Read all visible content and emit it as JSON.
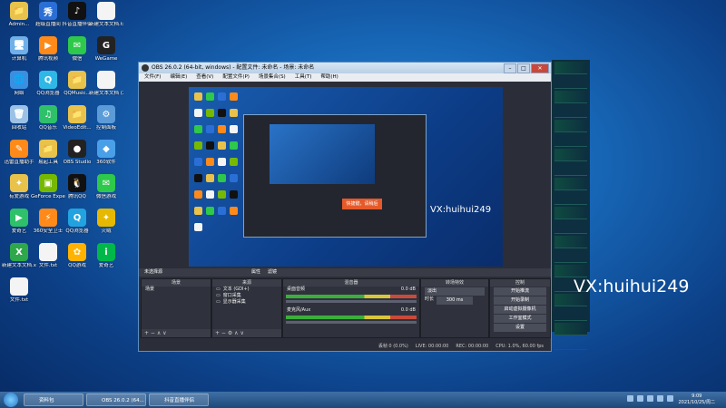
{
  "desktop": {
    "icons": [
      {
        "label": "Admin...",
        "color": "#e8c24a",
        "glyph": "📁"
      },
      {
        "label": "超级直播间",
        "color": "#2b6fd6",
        "glyph": "秀"
      },
      {
        "label": "抖音直播伴侣",
        "color": "#111111",
        "glyph": "♪"
      },
      {
        "label": "新建文本文档.txt",
        "color": "#f4f4f4",
        "glyph": ""
      },
      {
        "label": "计算机",
        "color": "#6fb0e8",
        "glyph": "🖥"
      },
      {
        "label": "腾讯视频",
        "color": "#ff8a1a",
        "glyph": "▶"
      },
      {
        "label": "微信",
        "color": "#2ec84a",
        "glyph": "✉"
      },
      {
        "label": "WeGame",
        "color": "#222222",
        "glyph": "G"
      },
      {
        "label": "网络",
        "color": "#3a8fe0",
        "glyph": "🌐"
      },
      {
        "label": "QQ浏览器",
        "color": "#2fb8e6",
        "glyph": "Q"
      },
      {
        "label": "QQMusic...",
        "color": "#e8c24a",
        "glyph": "📁"
      },
      {
        "label": "新建文本文档 (2).txt",
        "color": "#f4f4f4",
        "glyph": ""
      },
      {
        "label": "回收站",
        "color": "#9bc2e6",
        "glyph": "🗑"
      },
      {
        "label": "QQ音乐",
        "color": "#2fc06a",
        "glyph": "♫"
      },
      {
        "label": "VideoEdit...",
        "color": "#e8c24a",
        "glyph": "📁"
      },
      {
        "label": "控制面板",
        "color": "#5b9bd8",
        "glyph": "⚙"
      },
      {
        "label": "迅雷直播助手",
        "color": "#ff8a1a",
        "glyph": "✎"
      },
      {
        "label": "易起工具",
        "color": "#e8c24a",
        "glyph": "📁"
      },
      {
        "label": "OBS Studio",
        "color": "#222222",
        "glyph": "●"
      },
      {
        "label": "360软件",
        "color": "#4aa0e8",
        "glyph": "◆"
      },
      {
        "label": "有爱游戏",
        "color": "#e8c24a",
        "glyph": "✦"
      },
      {
        "label": "GeForce Experience",
        "color": "#76b900",
        "glyph": "▣"
      },
      {
        "label": "腾讯QQ",
        "color": "#111111",
        "glyph": "🐧"
      },
      {
        "label": "微信游戏",
        "color": "#2ec84a",
        "glyph": "✉"
      },
      {
        "label": "爱奇艺",
        "color": "#2fc06a",
        "glyph": "▶"
      },
      {
        "label": "360安全卫士",
        "color": "#ff8a1a",
        "glyph": "⚡"
      },
      {
        "label": "QQ浏览器",
        "color": "#22a3e0",
        "glyph": "Q"
      },
      {
        "label": "火绒",
        "color": "#e6b800",
        "glyph": "✦"
      },
      {
        "label": "新建文本文档.xlsx",
        "color": "#2ea84a",
        "glyph": "X"
      },
      {
        "label": "文件.txt",
        "color": "#f4f4f4",
        "glyph": ""
      },
      {
        "label": "QQ游戏",
        "color": "#ffb300",
        "glyph": "✿"
      },
      {
        "label": "爱奇艺",
        "color": "#00b84a",
        "glyph": "i"
      },
      {
        "label": "文件.txt",
        "color": "#f4f4f4",
        "glyph": ""
      }
    ]
  },
  "obs": {
    "title": "OBS 26.0.2 (64-bit, windows) - 配置文件: 未命名 - 场景: 未命名",
    "menu": [
      "文件(F)",
      "编辑(E)",
      "查看(V)",
      "配置文件(P)",
      "场景集合(S)",
      "工具(T)",
      "帮助(H)"
    ],
    "preview_watermark": "VX:huihui249",
    "preview_popup": "快捷键，请稍后",
    "scene_name_strip": "未选择源",
    "strip_items": [
      "属性",
      "滤镜"
    ],
    "docks": {
      "scenes": {
        "header": "场景",
        "items": [
          "场景"
        ]
      },
      "sources": {
        "header": "来源",
        "items": [
          "文本 (GDI+)",
          "窗口采集",
          "显示器采集"
        ]
      },
      "mixer": {
        "header": "混音器",
        "tracks": [
          {
            "name": "桌面音频",
            "db": "0.0 dB"
          },
          {
            "name": "麦克风/Aux",
            "db": "0.0 dB"
          }
        ]
      },
      "transitions": {
        "header": "转场特效",
        "type": "淡出",
        "duration_label": "时长",
        "duration": "300 ms"
      },
      "controls": {
        "header": "控制",
        "buttons": [
          "开始推流",
          "开始录制",
          "启动虚拟摄像机",
          "工作室模式",
          "设置",
          "退出"
        ]
      }
    },
    "status": {
      "dropped": "丢帧 0 (0.0%)",
      "live": "LIVE: 00:00:00",
      "rec": "REC: 00:00:00",
      "cpu": "CPU: 1.0%, 60.00 fps"
    }
  },
  "overlay": {
    "watermark": "VX:huihui249"
  },
  "taskbar": {
    "items": [
      {
        "label": "资料包",
        "color": "#e8c24a"
      },
      {
        "label": "OBS 26.0.2 (64...",
        "color": "#222222"
      },
      {
        "label": "抖音直播伴侣",
        "color": "#ff8a1a"
      }
    ],
    "time": "9:09",
    "date": "2021/10/25/周二"
  }
}
